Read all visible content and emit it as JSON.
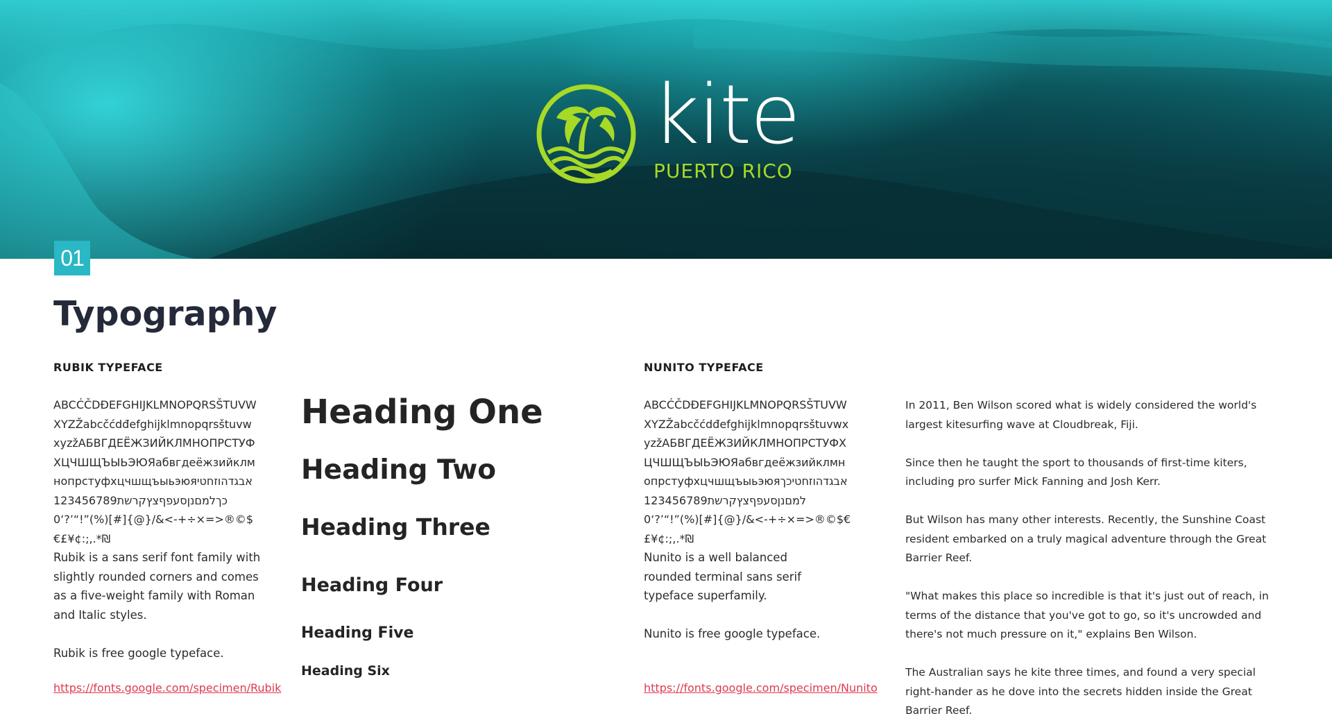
{
  "hero": {
    "logo_word": "kite",
    "logo_sub": "PUERTO RICO",
    "logo_color": "#a7d927",
    "background_color": "#0e5a62"
  },
  "section": {
    "number": "01",
    "title": "Typography",
    "badge_color": "#29b8c4"
  },
  "rubik": {
    "label": "RUBIK TYPEFACE",
    "glyphs": "ABCĆČDĐEFGHIJKLMNOPQRSŠTUVWXYZŽabcčćdđefghijklmnopqrsštuvwxyzžАБВГДЕЁЖЗИЙКЛМНОПРСТУФХЦЧШЩЪЫЬЭЮЯабвгдеёжзийклмнопрстуфхцчшщъыьэюяאבגדהוזחטיכךלמםנןסעפףצץקרשת1234567890‘?’“!”(%)[#]{@}/&<-+÷×=>®©$€£¥¢:;,.*₪",
    "description": "Rubik is a sans serif font family with slightly rounded corners and comes as a five-weight family with Roman and Italic styles.",
    "free_note": "Rubik is free google typeface.",
    "link": "https://fonts.google.com/specimen/Rubik"
  },
  "headings": {
    "h1": "Heading One",
    "h2": "Heading Two",
    "h3": "Heading Three",
    "h4": "Heading Four",
    "h5": "Heading Five",
    "h6": "Heading Six"
  },
  "nunito": {
    "label": "NUNITO TYPEFACE",
    "glyphs": "ABCĆČDĐEFGHIJKLMNOPQRSŠTUVWXYZŽabcčćdđefghijklmnopqrsštuvwxyzžАБВГДЕЁЖЗИЙКЛМНОПРСТУФХЦЧШЩЪЫЬЭЮЯабвгдеёжзийклмнопрстуфхцчшщъыьэюяאבגדהוזחטיכךלמםנןסעפףצץקרשת1234567890‘?’“!”(%)[#]{@}/&<-+÷×=>®©$€£¥¢:;,.*₪",
    "description": "Nunito is a well balanced rounded terminal sans serif typeface superfamily.",
    "free_note": "Nunito is free google typeface.",
    "link": "https://fonts.google.com/specimen/Nunito"
  },
  "article": {
    "paragraphs": [
      "In 2011, Ben Wilson scored what is widely considered the world's largest kitesurfing wave at Cloudbreak, Fiji.",
      "Since then he taught the sport to thousands of first-time kiters, including pro surfer Mick Fanning and Josh Kerr.",
      "But Wilson has many other interests. Recently, the Sunshine Coast resident embarked on a truly magical adventure through the Great Barrier Reef.",
      "\"What makes this place so incredible is that it's just out of reach, in terms of the distance that you've got to go, so it's uncrowded and there's not much pressure on it,\" explains Ben Wilson.",
      "The Australian says he kite three times, and found a very special right-hander as he dove into the secrets hidden inside the Great Barrier Reef."
    ]
  },
  "link_color": "#e0394e"
}
